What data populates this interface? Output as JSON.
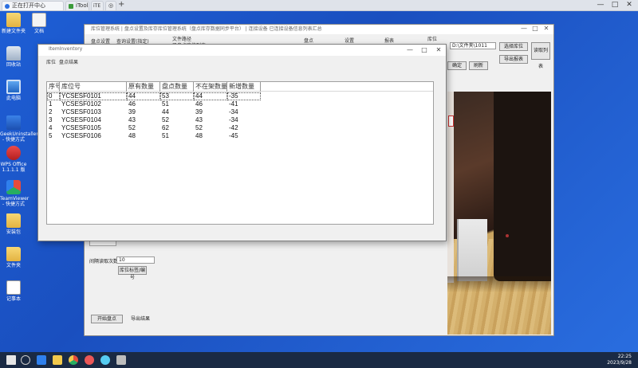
{
  "browser": {
    "tabs": [
      {
        "label": "正在打开中心"
      },
      {
        "label": "iTools"
      },
      {
        "label": "iTE"
      },
      {
        "label": "◎"
      }
    ],
    "new_tab": "+",
    "minimize": "—",
    "maximize": "□",
    "close": "✕"
  },
  "desktop_icons": [
    {
      "label": "新建文件夹"
    },
    {
      "label": "文档"
    },
    {
      "label": "回收站"
    },
    {
      "label": "此电脑"
    },
    {
      "label": "GeekUninstaller - 快捷方式"
    },
    {
      "label": "WPS Office 1.1.1.1 版"
    },
    {
      "label": "TeamViewer - 快捷方式"
    },
    {
      "label": "安装包"
    },
    {
      "label": "文件夹"
    },
    {
      "label": "记事本"
    }
  ],
  "back_window": {
    "title": "库位管理系统 | 盘点设置及库存库位管理系统（盘点库存数据同步平台）   | 连接设备   已连接设备信息列表汇总",
    "menu": [
      "盘点设置",
      "查询设置(指定)",
      "文件路径",
      "盘点",
      "设置",
      "报表",
      "库位"
    ],
    "menu_sub": "已盘点库位列表",
    "path_value": "D:\\文件夹\\1011",
    "buttons": {
      "b1": "选择库位",
      "b2": "导出报表",
      "b3": "确定",
      "b4": "刷新",
      "b5": "读取列表",
      "start": "开始盘点",
      "load": "导出结果"
    },
    "label_interval": "间隔读取次数",
    "interval_value": "10",
    "label_range": "库位标签/编号"
  },
  "dialog": {
    "title": "ItemInventory",
    "minimize": "—",
    "maximize": "□",
    "close": "✕",
    "menu": [
      "库位",
      "盘点结果"
    ],
    "columns": [
      "序号",
      "库位号",
      "原有数量",
      "盘点数量",
      "不在架数量",
      "新增数量"
    ],
    "rows": [
      {
        "idx": "0",
        "loc": "YCSESF0101",
        "orig": "44",
        "count": "53",
        "absent": "44",
        "added": "-35"
      },
      {
        "idx": "1",
        "loc": "YCSESF0102",
        "orig": "46",
        "count": "51",
        "absent": "46",
        "added": "-41"
      },
      {
        "idx": "2",
        "loc": "YCSESF0103",
        "orig": "39",
        "count": "44",
        "absent": "39",
        "added": "-34"
      },
      {
        "idx": "3",
        "loc": "YCSESF0104",
        "orig": "43",
        "count": "52",
        "absent": "43",
        "added": "-34"
      },
      {
        "idx": "4",
        "loc": "YCSESF0105",
        "orig": "52",
        "count": "62",
        "absent": "52",
        "added": "-42"
      },
      {
        "idx": "5",
        "loc": "YCSESF0106",
        "orig": "48",
        "count": "51",
        "absent": "48",
        "added": "-45"
      }
    ]
  },
  "taskbar": {
    "time": "22:25",
    "date": "2023/9/28"
  }
}
